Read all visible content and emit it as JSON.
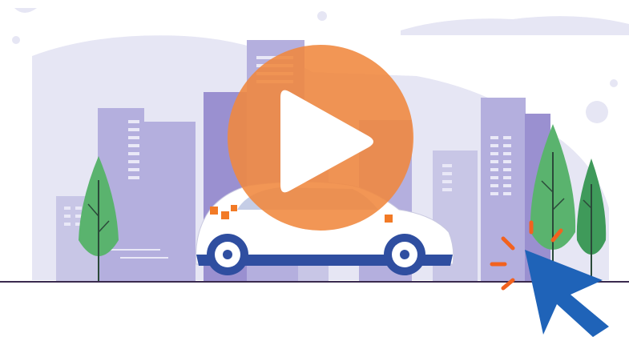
{
  "video": {
    "state": "paused"
  },
  "colors": {
    "background": "#ffffff",
    "sky_blob": "#e6e6f4",
    "building_light": "#c8c6e6",
    "building_mid": "#b4afde",
    "building_dark": "#9a90d0",
    "window": "#e9e8f7",
    "ground_line": "#3a2a4e",
    "tree_green": "#5ab36e",
    "tree_green_dark": "#3f9a5a",
    "car_body": "#ffffff",
    "car_trim": "#2f4ea0",
    "car_accent": "#f27a26",
    "play_circle": "#f0883e",
    "play_triangle": "#ffffff",
    "cursor": "#1f63b8",
    "click_rays": "#f2621f"
  },
  "icons": {
    "play": "play-icon",
    "cursor": "mouse-pointer-icon",
    "click": "click-burst-icon"
  }
}
